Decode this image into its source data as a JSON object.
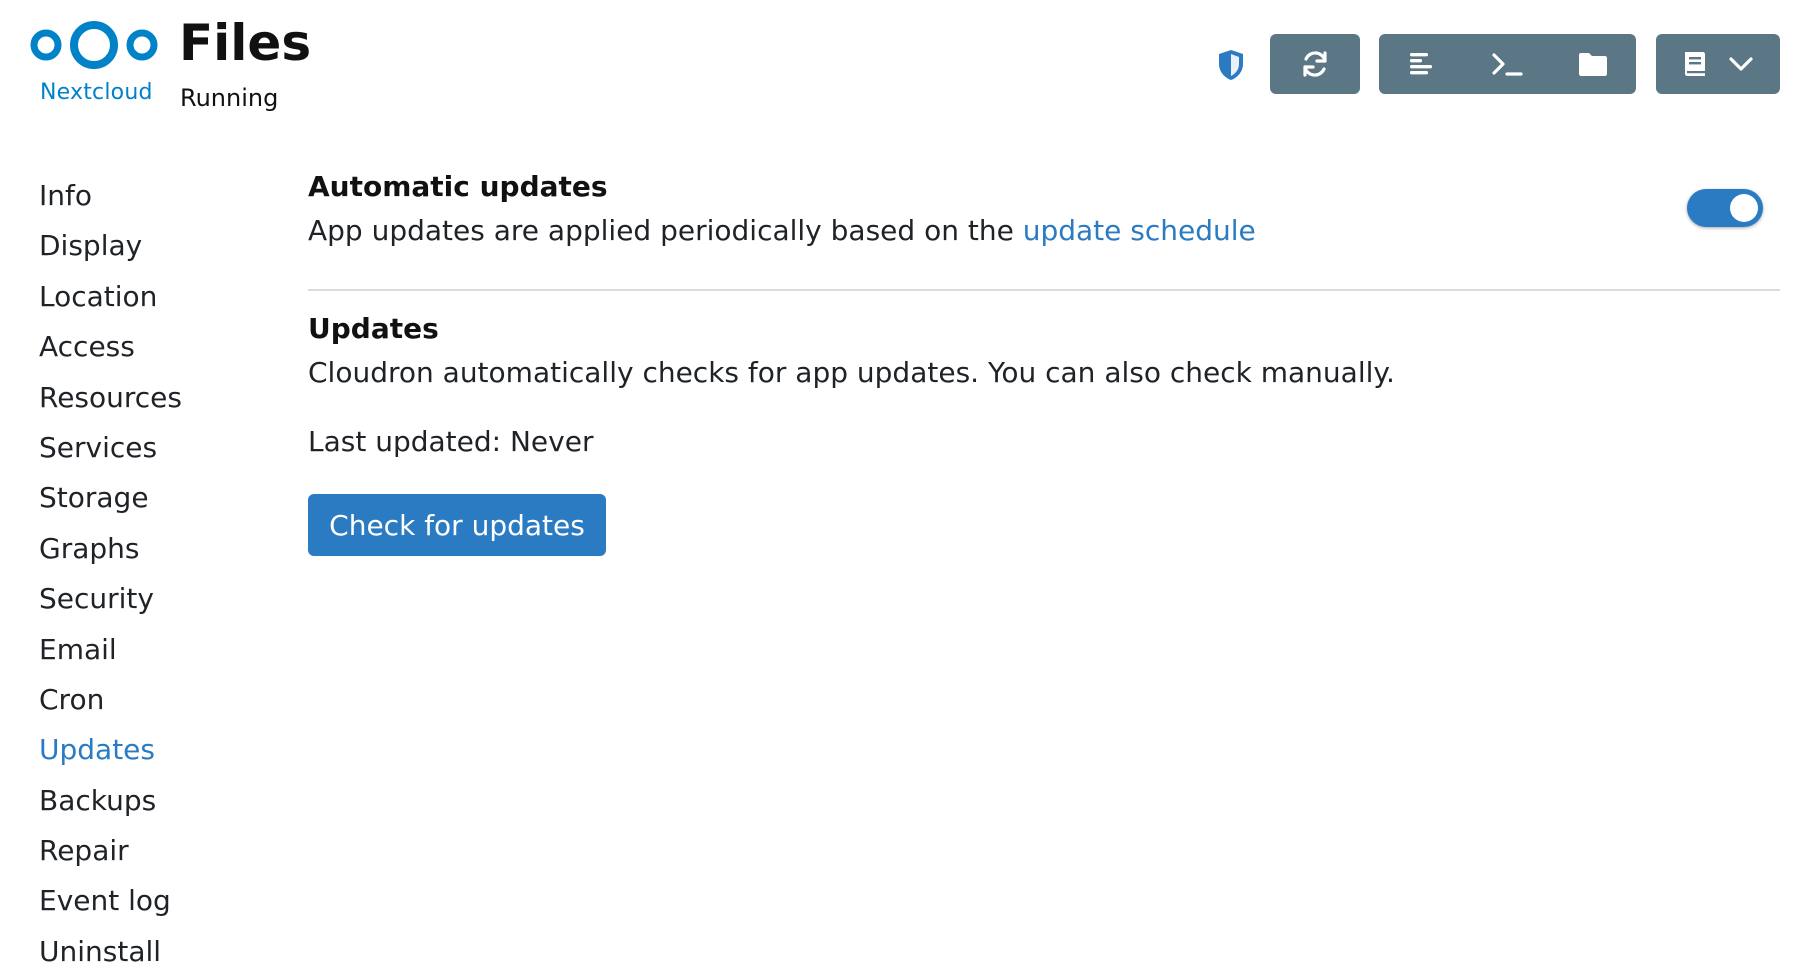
{
  "header": {
    "logo_text": "Nextcloud",
    "app_title": "Files",
    "app_status": "Running",
    "icons": {
      "shield": "shield-icon",
      "restart": "refresh-icon",
      "logs": "logs-icon",
      "terminal": "terminal-icon",
      "files": "folder-icon",
      "docs": "book-icon",
      "chevron": "chevron-down-icon"
    }
  },
  "sidebar": {
    "items": [
      {
        "label": "Info"
      },
      {
        "label": "Display"
      },
      {
        "label": "Location"
      },
      {
        "label": "Access"
      },
      {
        "label": "Resources"
      },
      {
        "label": "Services"
      },
      {
        "label": "Storage"
      },
      {
        "label": "Graphs"
      },
      {
        "label": "Security"
      },
      {
        "label": "Email"
      },
      {
        "label": "Cron"
      },
      {
        "label": "Updates",
        "active": true
      },
      {
        "label": "Backups"
      },
      {
        "label": "Repair"
      },
      {
        "label": "Event log"
      },
      {
        "label": "Uninstall"
      }
    ]
  },
  "main": {
    "auto_updates": {
      "title": "Automatic updates",
      "text_prefix": "App updates are applied periodically based on the ",
      "link": "update schedule",
      "enabled": true
    },
    "updates": {
      "title": "Updates",
      "text": "Cloudron automatically checks for app updates. You can also check manually.",
      "last_updated": "Last updated: Never",
      "check_button": "Check for updates"
    }
  },
  "colors": {
    "accent": "#2b7bc3",
    "toolbar_button": "#5b7684",
    "brand": "#0082c9"
  }
}
